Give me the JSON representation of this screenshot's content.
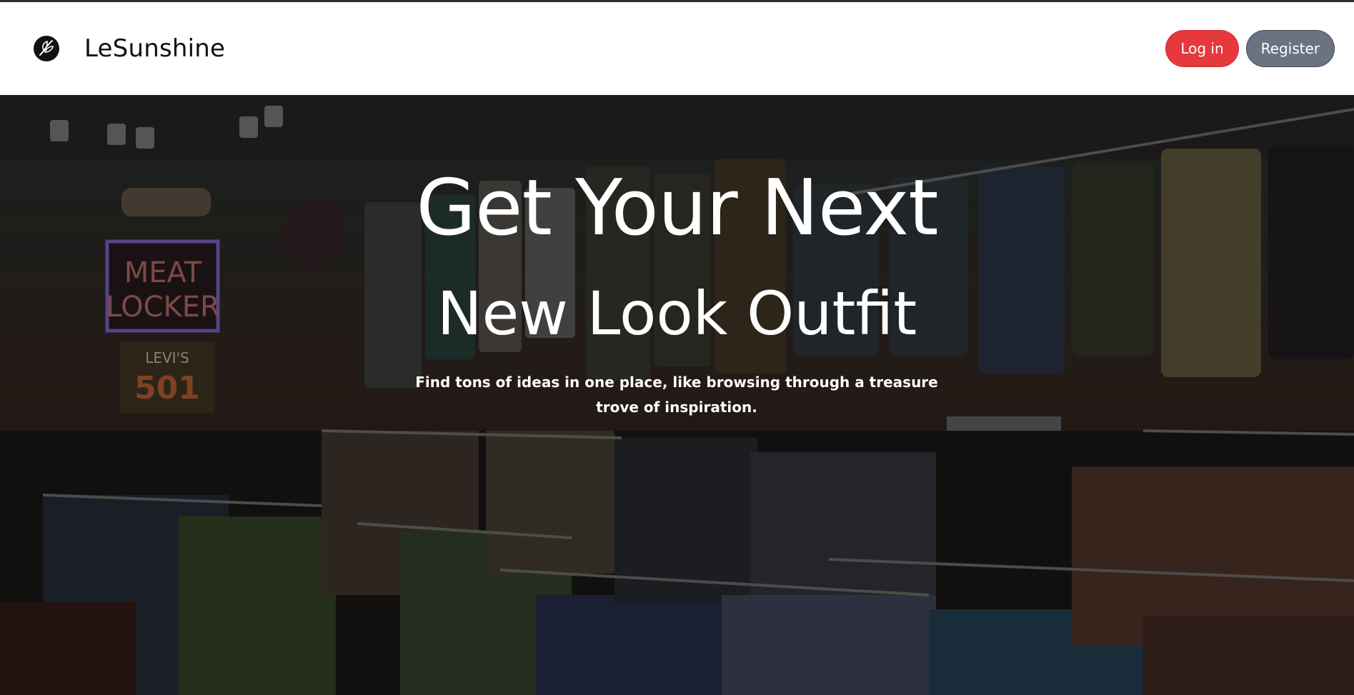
{
  "nav": {
    "brand_name": "LeSunshine",
    "login_label": "Log in",
    "register_label": "Register"
  },
  "hero": {
    "headline_line1": "Get Your Next",
    "headline_line2": "New Look Outfit",
    "subtext": "Find tons of ideas in one place, like browsing through a treasure trove of inspiration.",
    "background": "photo of a vintage clothing store with racks of hanging jackets and shirts",
    "sign_text": [
      "MEAT",
      "LOCKER"
    ],
    "brand_sign": [
      "LEVI'S",
      "501"
    ]
  },
  "colors": {
    "login_button": "#e5393e",
    "register_button": "#6b7280",
    "navbar_bg": "#ffffff",
    "hero_text": "#ffffff"
  },
  "icons": {
    "logo": "leaf-logo-icon"
  }
}
